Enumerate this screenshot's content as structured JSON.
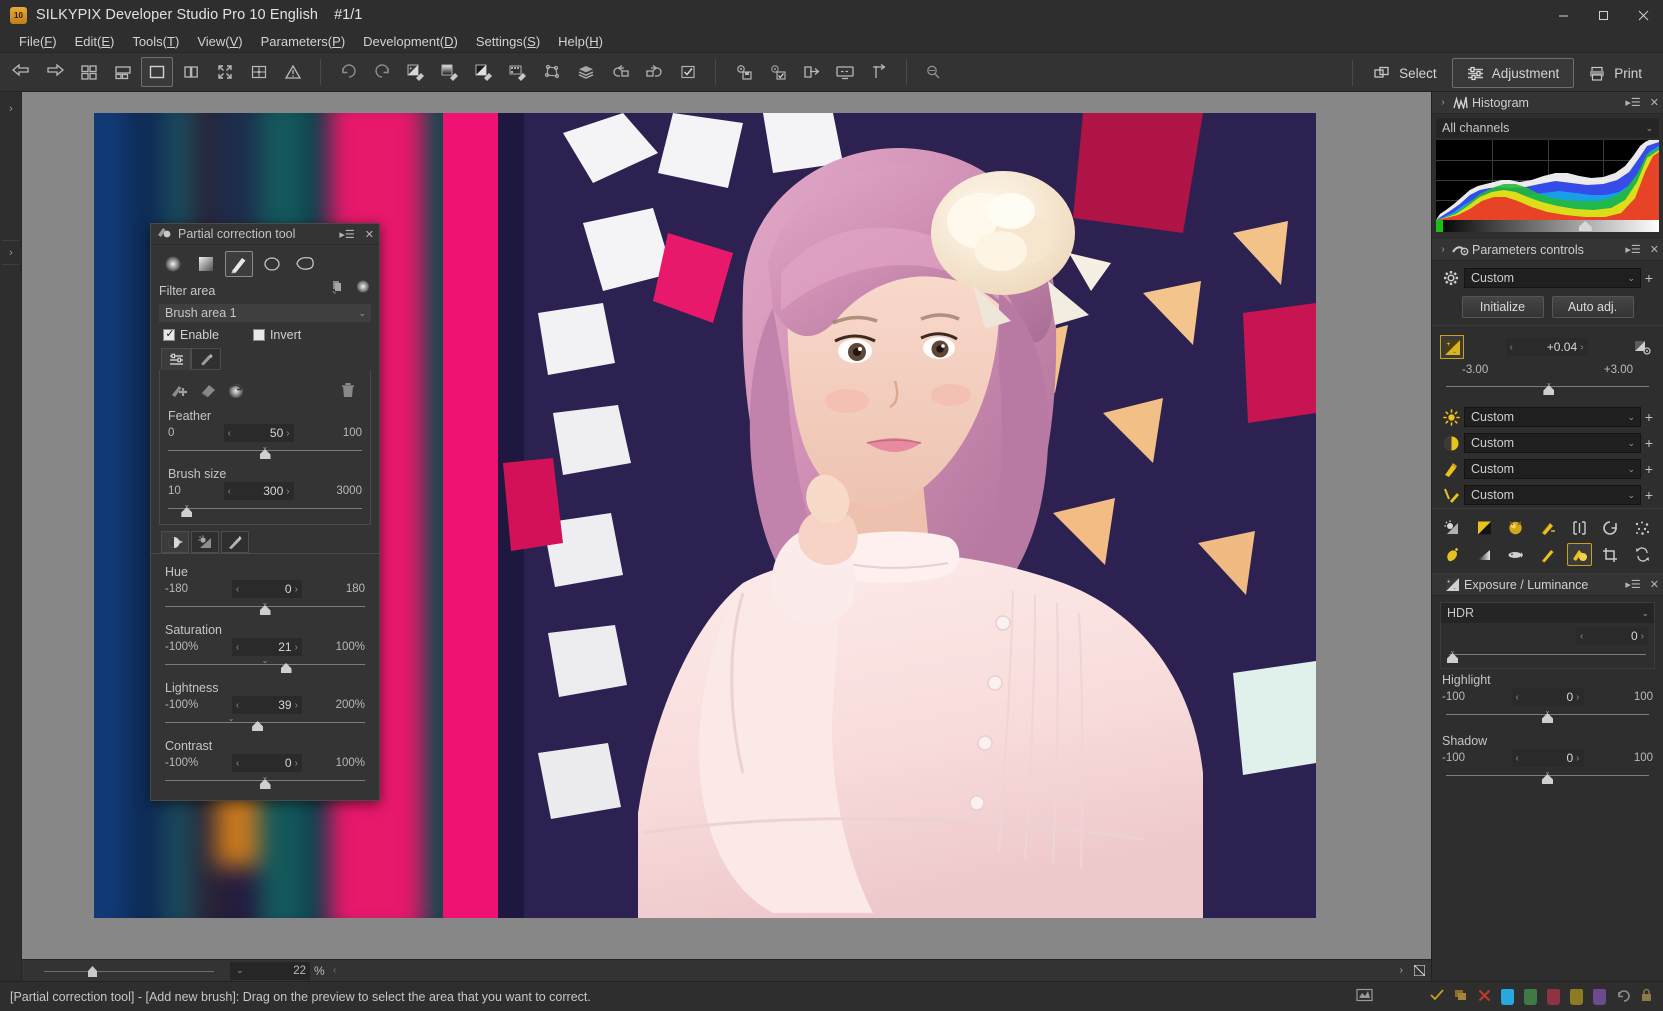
{
  "window": {
    "title": "SILKYPIX Developer Studio Pro 10 English",
    "image_counter": "#1/1",
    "logo_text": "10",
    "minimize": "—",
    "maximize": "□",
    "close": "✕"
  },
  "menubar": [
    {
      "label": "File(F)",
      "pre": "File(",
      "key": "F",
      "post": ")"
    },
    {
      "label": "Edit(E)",
      "pre": "Edit(",
      "key": "E",
      "post": ")"
    },
    {
      "label": "Tools(T)",
      "pre": "Tools(",
      "key": "T",
      "post": ")"
    },
    {
      "label": "View(V)",
      "pre": "View(",
      "key": "V",
      "post": ")"
    },
    {
      "label": "Parameters(P)",
      "pre": "Parameters(",
      "key": "P",
      "post": ")"
    },
    {
      "label": "Development(D)",
      "pre": "Development(",
      "key": "D",
      "post": ")"
    },
    {
      "label": "Settings(S)",
      "pre": "Settings(",
      "key": "S",
      "post": ")"
    },
    {
      "label": "Help(H)",
      "pre": "Help(",
      "key": "H",
      "post": ")"
    }
  ],
  "toolbar": {
    "mode_select": "Select",
    "mode_adjustment": "Adjustment",
    "mode_print": "Print",
    "icons_group1": [
      "prev-image-icon",
      "next-image-icon",
      "thumbnail-grid-icon",
      "filmstrip-icon",
      "single-view-icon",
      "split-view-icon",
      "fullscreen-icon",
      "compare-grid-icon",
      "warning-icon"
    ],
    "icons_group2": [
      "undo-icon",
      "redo-icon",
      "exposure-dropper-icon",
      "gradient-dropper-icon",
      "tone-dropper-icon",
      "film-dropper-icon",
      "polygon-select-icon",
      "layers-icon",
      "rotate-left-icon",
      "rotate-right-icon",
      "checkbox-mark-icon"
    ],
    "icons_group3": [
      "save-settings-icon",
      "apply-settings-icon",
      "export-icon",
      "slideshow-icon",
      "flag-icon"
    ],
    "icons_group4": [
      "search-zoom-icon"
    ]
  },
  "partial_correction": {
    "title": "Partial correction tool",
    "shapes": [
      "radial-gradient-shape",
      "linear-gradient-shape",
      "brush-shape",
      "circle-shape",
      "freeform-shape"
    ],
    "active_shape_index": 2,
    "filter_area_label": "Filter area",
    "brush_area": "Brush area 1",
    "enable_label": "Enable",
    "enable_checked": true,
    "invert_label": "Invert",
    "invert_checked": false,
    "tab_active_index": 0,
    "tools": [
      "add-brush-icon",
      "eraser-icon",
      "refill-icon"
    ],
    "delete_icon": "trash-icon",
    "sliders": [
      {
        "label": "Feather",
        "min": "0",
        "value": "50",
        "max": "100",
        "knob_pct": 50,
        "default_pct": 50
      },
      {
        "label": "Brush size",
        "min": "10",
        "value": "300",
        "max": "3000",
        "knob_pct": 9.7,
        "default_pct": 9.7
      }
    ],
    "effect_tabs": [
      "hue-saturation-tab",
      "light-tab",
      "sharpen-tab"
    ],
    "effect_tab_active": 0,
    "effect_sliders": [
      {
        "label": "Hue",
        "min": "-180",
        "value": "0",
        "max": "180",
        "knob_pct": 50,
        "default_pct": 50
      },
      {
        "label": "Saturation",
        "min": "-100%",
        "value": "21",
        "max": "100%",
        "knob_pct": 60.5,
        "default_pct": 50
      },
      {
        "label": "Lightness",
        "min": "-100%",
        "value": "39",
        "max": "200%",
        "knob_pct": 46.3,
        "default_pct": 33
      },
      {
        "label": "Contrast",
        "min": "-100%",
        "value": "0",
        "max": "100%",
        "knob_pct": 50,
        "default_pct": 50
      }
    ]
  },
  "histogram": {
    "title": "Histogram",
    "channel_mode": "All channels",
    "icon": "histogram-icon"
  },
  "parameters_controls": {
    "title": "Parameters controls",
    "icon": "parameters-icon",
    "preset": "Custom",
    "initialize_btn": "Initialize",
    "auto_adj_btn": "Auto adj.",
    "exposure": {
      "value": "+0.04",
      "min": "-3.00",
      "max": "+3.00",
      "knob_pct": 50.7,
      "icon": "exposure-bias-icon",
      "reset_icon": "exposure-reset-icon"
    },
    "rows": [
      {
        "icon": "white-balance-icon",
        "value": "Custom"
      },
      {
        "icon": "tone-curve-icon",
        "value": "Custom"
      },
      {
        "icon": "color-icon",
        "value": "Custom"
      },
      {
        "icon": "sharpness-icon",
        "value": "Custom"
      }
    ],
    "icon_grid_row1": [
      "exposure-luminance-icon",
      "tone-curve-icon",
      "color-sphere-icon",
      "color-balance-icon",
      "lens-aberration-icon",
      "rotate-reset-icon",
      "noise-reduction-icon"
    ],
    "icon_grid_row2": [
      "dodge-burn-icon",
      "gradation-icon",
      "fisheye-icon",
      "sharpen-brush-icon",
      "partial-correction-icon",
      "crop-icon",
      "transform-icon"
    ],
    "icon_grid_active": "partial-correction-icon"
  },
  "exposure_luminance": {
    "title": "Exposure / Luminance",
    "icon": "exposure-luminance-icon",
    "hdr_label": "HDR",
    "hdr_value": "0",
    "hdr_knob_pct": 2,
    "sliders": [
      {
        "label": "Highlight",
        "min": "-100",
        "value": "0",
        "max": "100",
        "knob_pct": 50
      },
      {
        "label": "Shadow",
        "min": "-100",
        "value": "0",
        "max": "100",
        "knob_pct": 50
      }
    ]
  },
  "viewer": {
    "zoom_value": "22",
    "zoom_unit": "%"
  },
  "statusbar": {
    "message": "[Partial correction tool] - [Add new brush]: Drag on the preview to select the area that you want to correct.",
    "icons": [
      "check-mark-icon",
      "copy-icon",
      "reject-x-icon"
    ],
    "tags": [
      "#29a8e0",
      "#3f7a45",
      "#8e3342",
      "#8e7a22",
      "#6b4a8e"
    ],
    "extra_icons": [
      "undo-arrow-icon",
      "lock-icon"
    ],
    "monitor_icon": "monitor-profile-icon"
  },
  "colors": {
    "accent_yellow": "#d9b320",
    "panel_bg": "#2e2e2e",
    "toolbar_bg": "#333333",
    "viewer_bg": "#878787",
    "text": "#c8c8c8"
  }
}
